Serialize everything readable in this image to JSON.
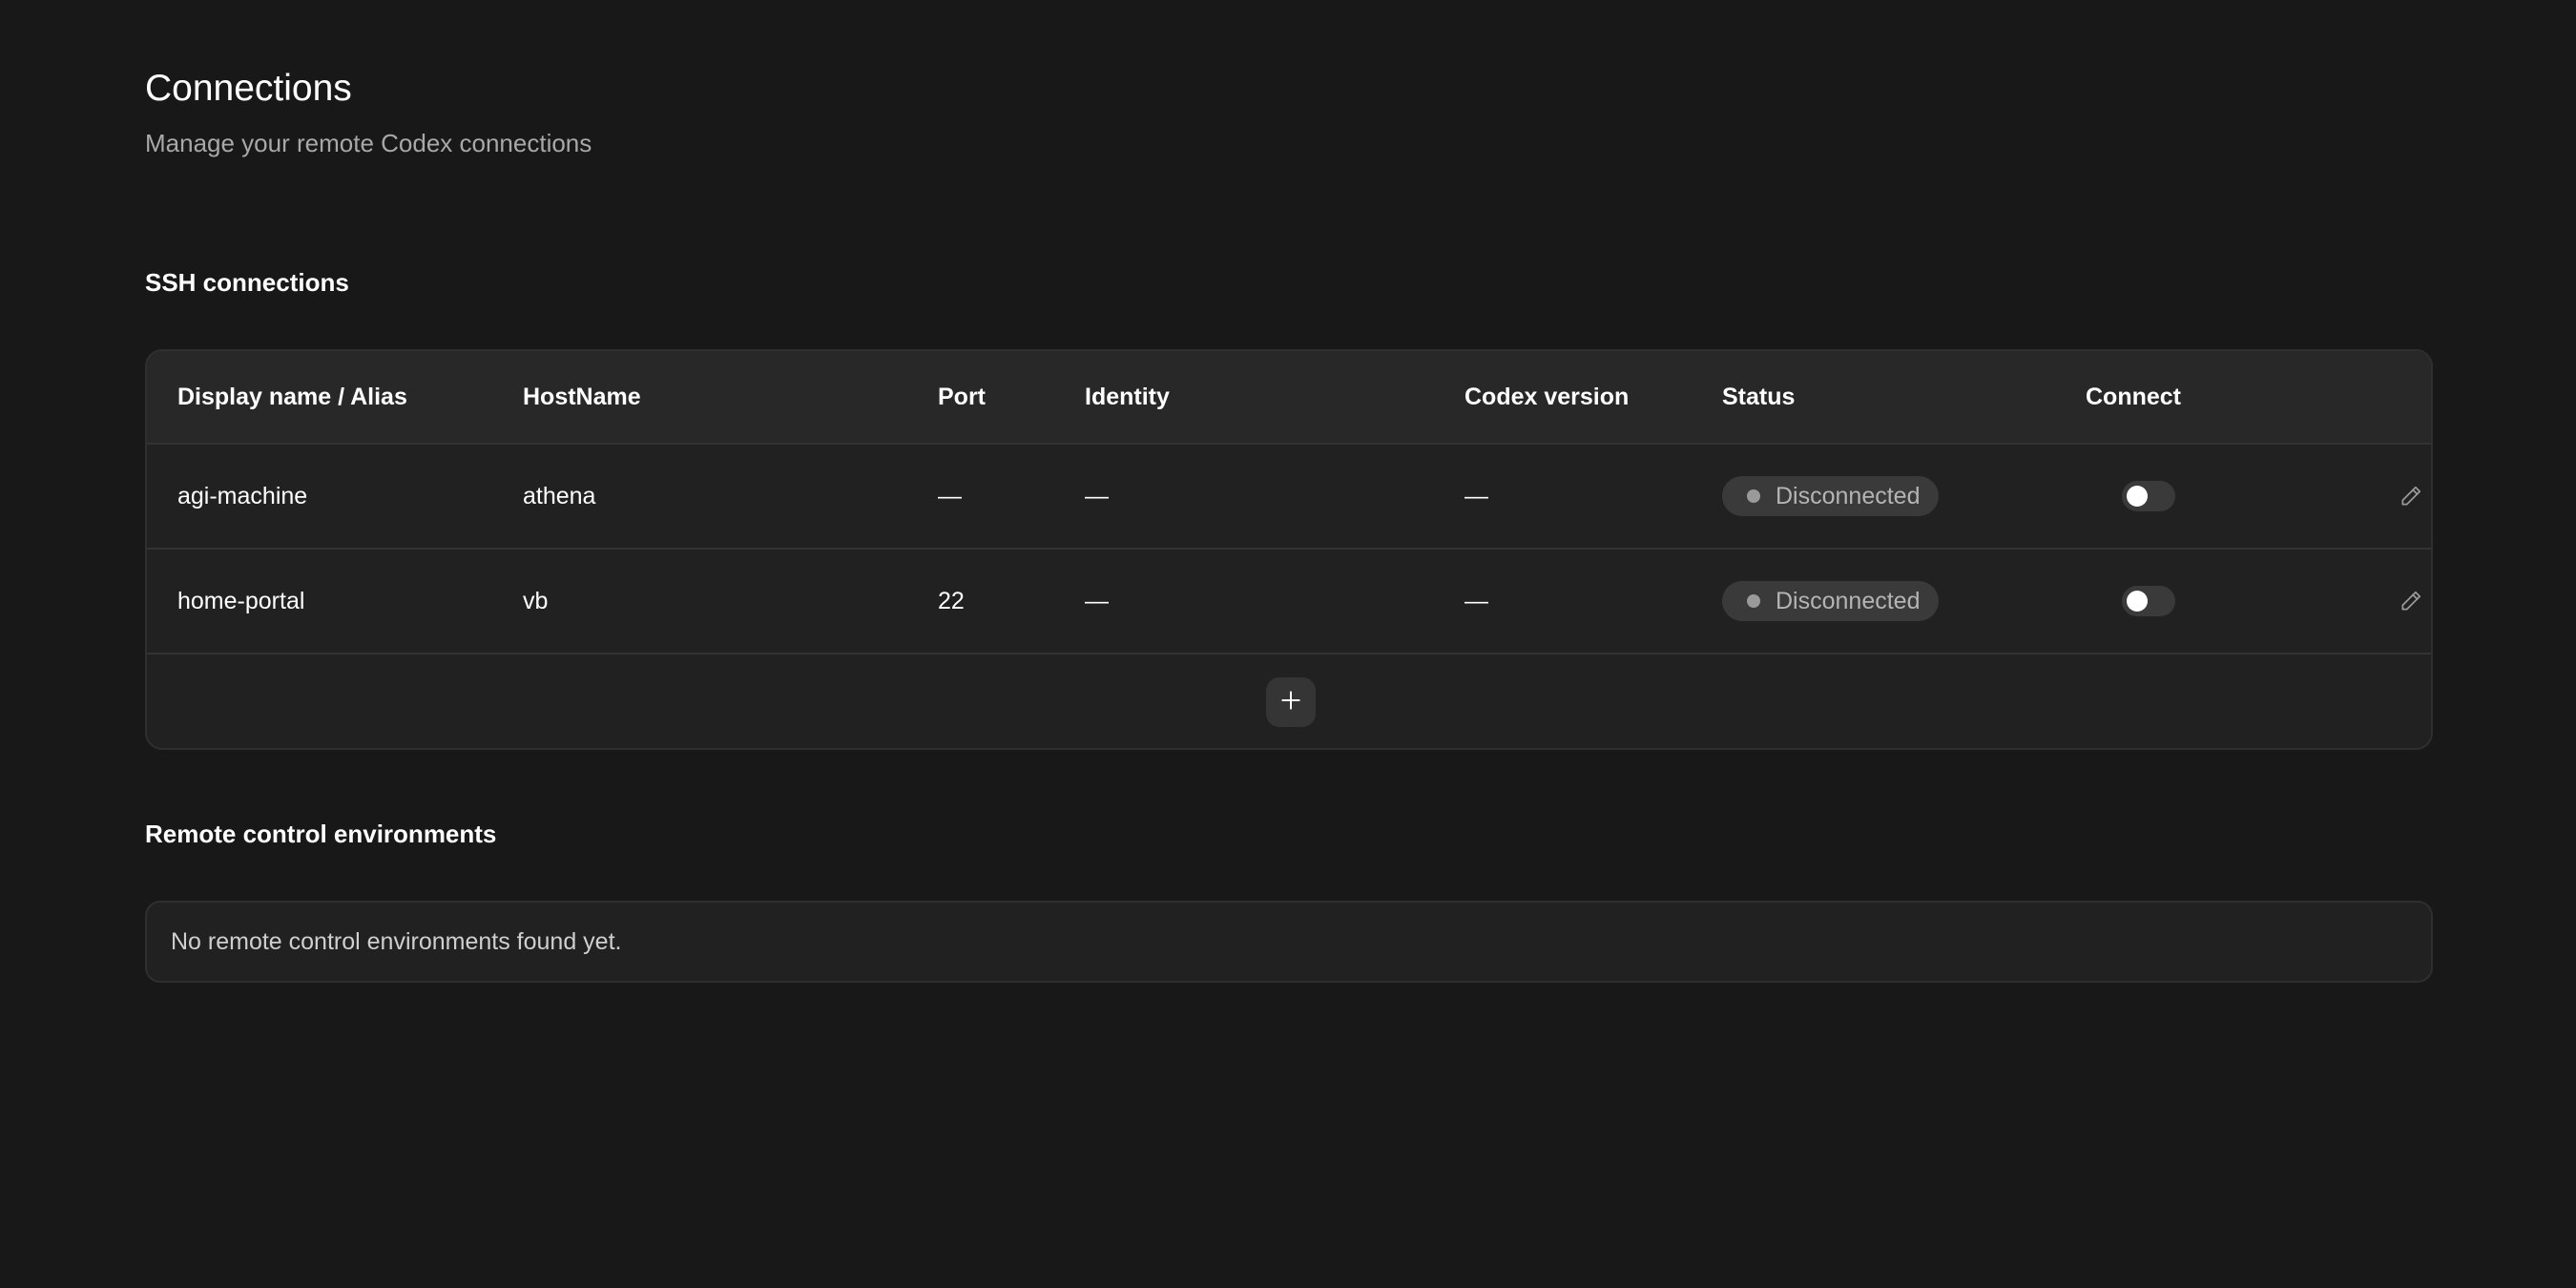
{
  "header": {
    "title": "Connections",
    "subtitle": "Manage your remote Codex connections"
  },
  "ssh": {
    "section_title": "SSH connections",
    "columns": {
      "name": "Display name / Alias",
      "host": "HostName",
      "port": "Port",
      "identity": "Identity",
      "codex_version": "Codex version",
      "status": "Status",
      "connect": "Connect"
    },
    "refresh_icon": "refresh-icon",
    "rows": [
      {
        "name": "agi-machine",
        "host": "athena",
        "port": "—",
        "identity": "—",
        "codex_version": "—",
        "status": "Disconnected",
        "connected": false
      },
      {
        "name": "home-portal",
        "host": "vb",
        "port": "22",
        "identity": "—",
        "codex_version": "—",
        "status": "Disconnected",
        "connected": false
      }
    ],
    "row_icons": [
      "pencil-icon",
      "trash-icon"
    ],
    "add_icon": "plus-icon"
  },
  "remote": {
    "section_title": "Remote control environments",
    "empty_message": "No remote control environments found yet."
  },
  "colors": {
    "background": "#181818",
    "card": "#212121",
    "header_row": "#282828",
    "badge": "#3a3a3a",
    "delete": "#e0656a"
  }
}
